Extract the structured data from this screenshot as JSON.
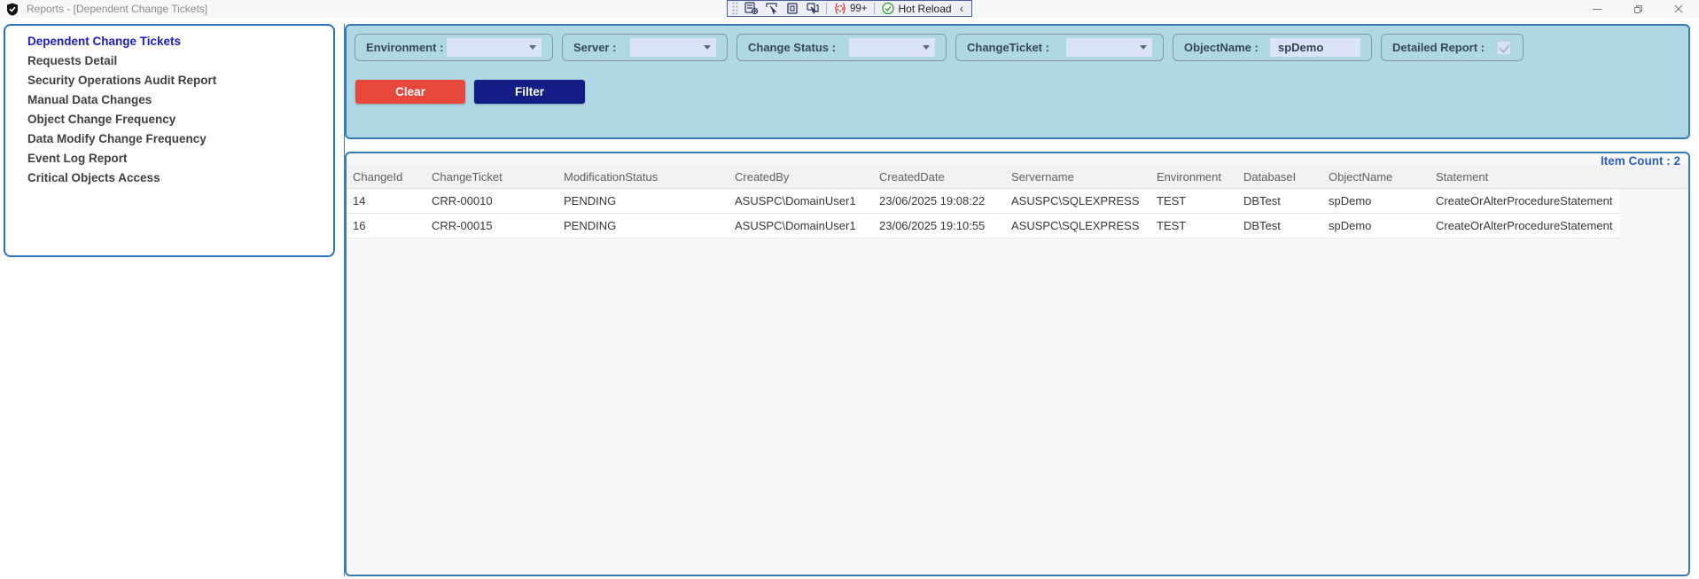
{
  "window": {
    "title": "Reports - [Dependent Change Tickets]"
  },
  "debug_toolbar": {
    "badge_count": "99+",
    "hot_reload_label": "Hot Reload",
    "collapse_glyph": "‹",
    "icons": [
      "grip-handle",
      "live-visual-tree-icon",
      "select-element-icon",
      "layout-adorners-icon",
      "track-focused-element-icon",
      "binding-errors-icon",
      "hot-reload-check-icon"
    ]
  },
  "sidebar": {
    "items": [
      {
        "label": "Dependent Change Tickets",
        "selected": true
      },
      {
        "label": "Requests Detail",
        "selected": false
      },
      {
        "label": "Security Operations Audit Report",
        "selected": false
      },
      {
        "label": "Manual Data Changes",
        "selected": false
      },
      {
        "label": "Object Change Frequency",
        "selected": false
      },
      {
        "label": "Data Modify Change Frequency",
        "selected": false
      },
      {
        "label": "Event Log Report",
        "selected": false
      },
      {
        "label": "Critical Objects Access",
        "selected": false
      }
    ]
  },
  "filters": {
    "environment_label": "Environment :",
    "server_label": "Server :",
    "change_status_label": "Change Status :",
    "change_ticket_label": "ChangeTicket :",
    "object_name_label": "ObjectName :",
    "object_name_value": "spDemo",
    "detailed_report_label": "Detailed Report :",
    "detailed_report_checked": true,
    "clear_label": "Clear",
    "filter_label": "Filter"
  },
  "table": {
    "item_count_label": "Item Count : 2",
    "columns": [
      "ChangeId",
      "ChangeTicket",
      "ModificationStatus",
      "CreatedBy",
      "CreatedDate",
      "Servername",
      "Environment",
      "DatabaseI",
      "ObjectName",
      "Statement"
    ],
    "rows": [
      [
        "14",
        "CRR-00010",
        "PENDING",
        "ASUSPC\\DomainUser1",
        "23/06/2025 19:08:22",
        "ASUSPC\\SQLEXPRESS",
        "TEST",
        "DBTest",
        "spDemo",
        "CreateOrAlterProcedureStatement"
      ],
      [
        "16",
        "CRR-00015",
        "PENDING",
        "ASUSPC\\DomainUser1",
        "23/06/2025 19:10:55",
        "ASUSPC\\SQLEXPRESS",
        "TEST",
        "DBTest",
        "spDemo",
        "CreateOrAlterProcedureStatement"
      ]
    ]
  },
  "colors": {
    "panel_background": "#AFD8E5",
    "panel_border": "#3879B0",
    "selected_item": "#1C1CD6",
    "clear_button": "#E8473C",
    "filter_button": "#141C86",
    "item_count": "#2C5FC9",
    "dropdown_fill": "#DAE3FA"
  }
}
